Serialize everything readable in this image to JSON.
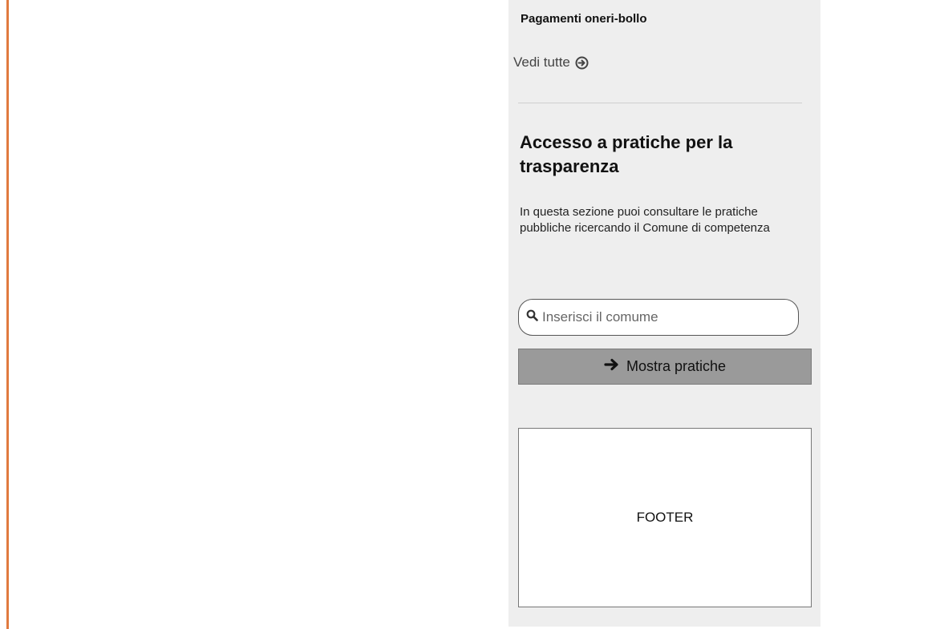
{
  "payments": {
    "title": "Pagamenti oneri-bollo",
    "see_all_label": "Vedi tutte",
    "see_all_icon": "circle-arrow-right-icon"
  },
  "transparency": {
    "heading": "Accesso a pratiche per la trasparenza",
    "description": "In questa sezione puoi consultare le pratiche pubbliche ricercando il Comune di competenza",
    "search": {
      "placeholder": "Inserisci il comume",
      "value": "",
      "icon": "search-icon"
    },
    "show_button_label": "Mostra pratiche",
    "show_button_icon": "arrow-right-icon"
  },
  "footer": {
    "label": "FOOTER"
  },
  "colors": {
    "accent_rule": "#e07a3f",
    "panel_background": "#eeeeee",
    "button_background": "#9a9a9a"
  }
}
